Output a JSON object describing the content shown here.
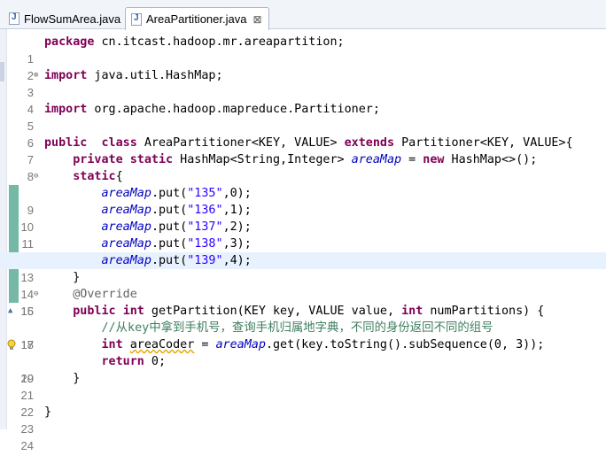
{
  "tabs": [
    {
      "label": "FlowSumArea.java",
      "active": false
    },
    {
      "label": "AreaPartitioner.java",
      "active": true,
      "close": "⊠"
    }
  ],
  "lines": [
    {
      "n": "1",
      "t": "package cn.itcast.hadoop.mr.areapartition;"
    },
    {
      "n": "2",
      "t": ""
    },
    {
      "n": "3",
      "t": "import java.util.HashMap;"
    },
    {
      "n": "4",
      "t": ""
    },
    {
      "n": "5",
      "t": "import org.apache.hadoop.mapreduce.Partitioner;"
    },
    {
      "n": "6",
      "t": ""
    },
    {
      "n": "7",
      "t": "public  class AreaPartitioner<KEY, VALUE> extends Partitioner<KEY, VALUE>{"
    },
    {
      "n": "8",
      "t": "    private static HashMap<String,Integer> areaMap = new HashMap<>();"
    },
    {
      "n": "9",
      "t": "    static{"
    },
    {
      "n": "10",
      "t": "        areaMap.put(\"135\",0);"
    },
    {
      "n": "11",
      "t": "        areaMap.put(\"136\",1);"
    },
    {
      "n": "12",
      "t": "        areaMap.put(\"137\",2);"
    },
    {
      "n": "13",
      "t": "        areaMap.put(\"138\",3);"
    },
    {
      "n": "14",
      "t": "        areaMap.put(\"139\",4);"
    },
    {
      "n": "15",
      "t": "    }"
    },
    {
      "n": "16",
      "t": "    @Override"
    },
    {
      "n": "17",
      "t": "    public int getPartition(KEY key, VALUE value, int numPartitions) {"
    },
    {
      "n": "18",
      "t": "        //从key中拿到手机号，查询手机归属地字典，不同的身份返回不同的组号"
    },
    {
      "n": "19",
      "t": "        int areaCoder = areaMap.get(key.toString().subSequence(0, 3));"
    },
    {
      "n": "20",
      "t": "        return 0;"
    },
    {
      "n": "21",
      "t": "    }"
    },
    {
      "n": "22",
      "t": ""
    },
    {
      "n": "23",
      "t": "}"
    },
    {
      "n": "24",
      "t": ""
    }
  ],
  "colors": {
    "keyword": "#7f0055",
    "string": "#2a00ff",
    "field": "#0000c0",
    "comment": "#3f7f5f",
    "annotation": "#646464",
    "current_line": "#e8f2fe",
    "change_marker": "#76b8a6"
  }
}
